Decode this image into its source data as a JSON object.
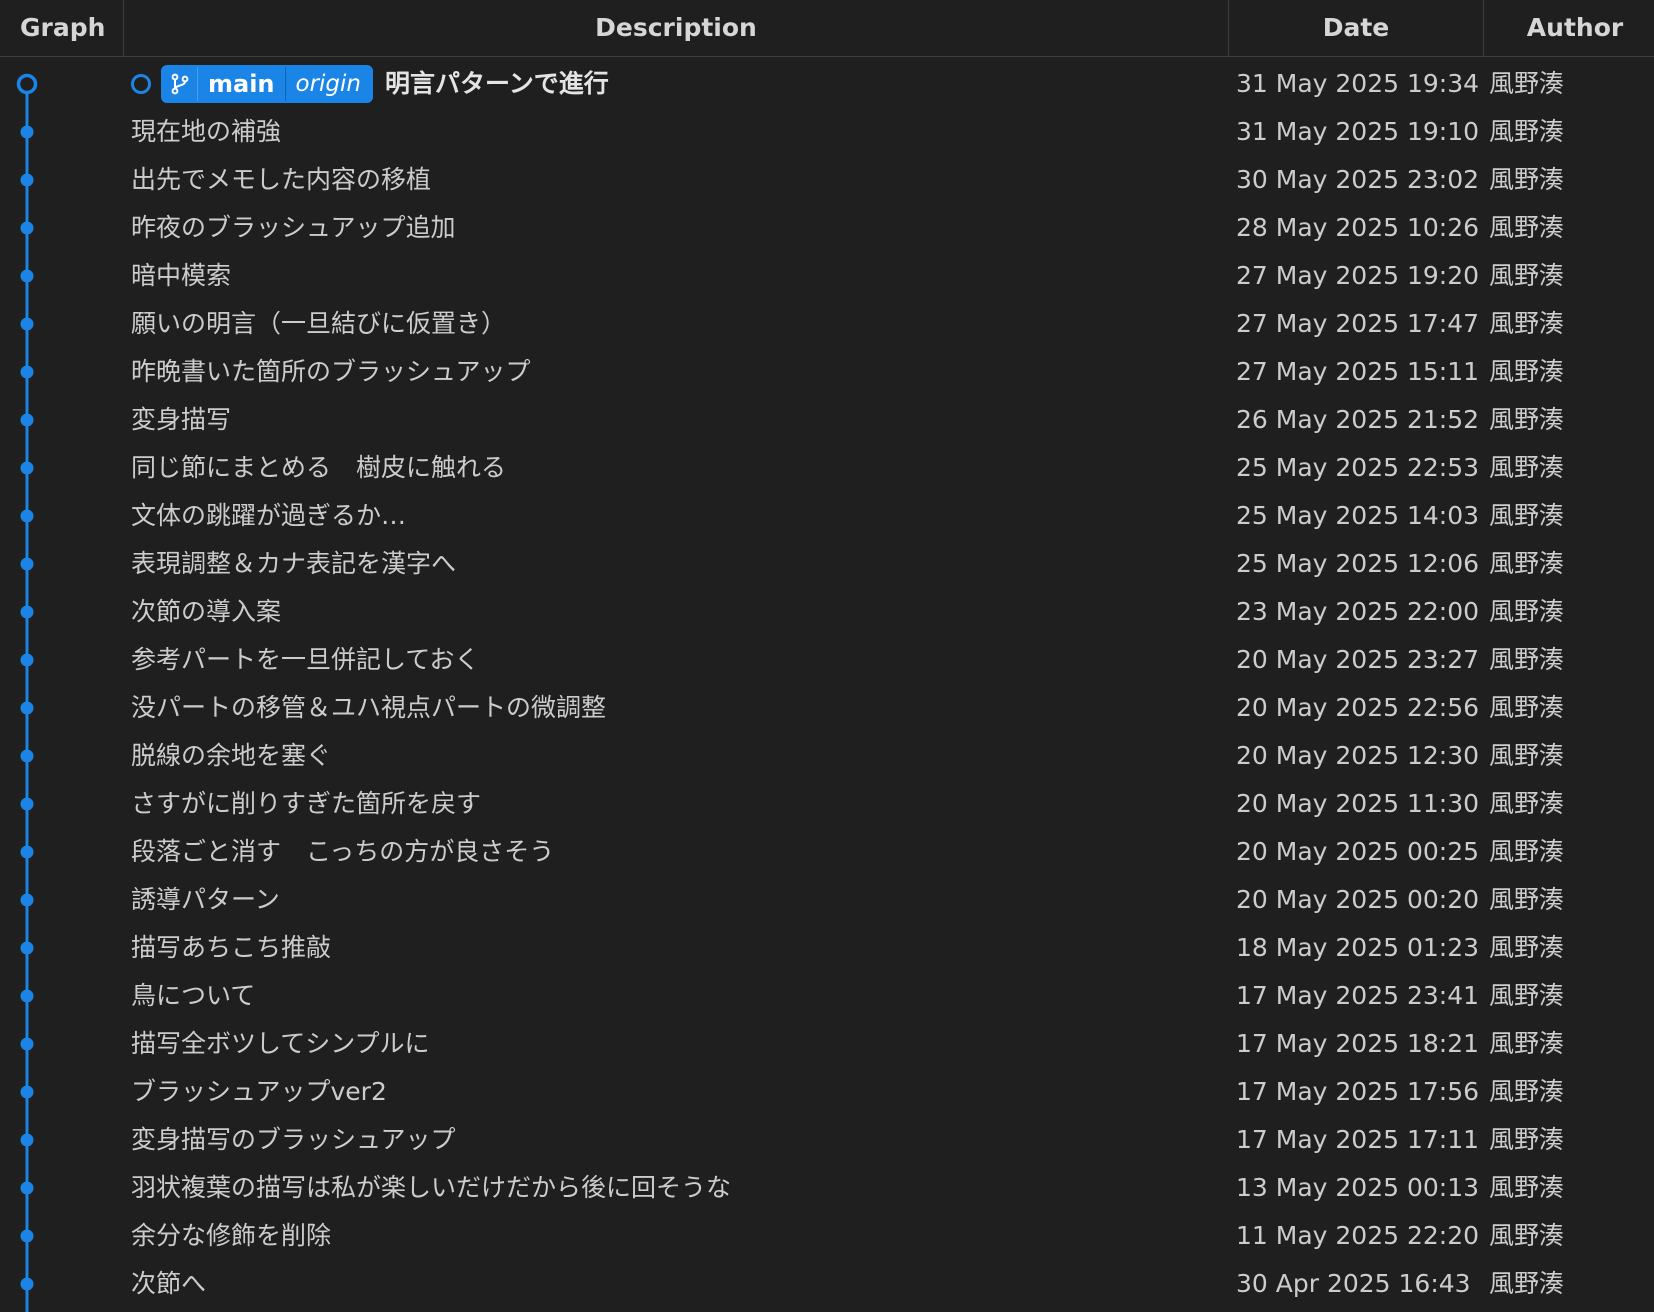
{
  "columns": {
    "graph": "Graph",
    "description": "Description",
    "date": "Date",
    "author": "Author"
  },
  "colors": {
    "accent": "#1a85e6",
    "background": "#1f1f1f"
  },
  "head_badge": {
    "branch_icon": "git-branch-icon",
    "branch": "main",
    "remote": "origin"
  },
  "commits": [
    {
      "description": "明言パターンで進行",
      "date": "31 May 2025 19:34",
      "author": "風野湊"
    },
    {
      "description": "現在地の補強",
      "date": "31 May 2025 19:10",
      "author": "風野湊"
    },
    {
      "description": "出先でメモした内容の移植",
      "date": "30 May 2025 23:02",
      "author": "風野湊"
    },
    {
      "description": "昨夜のブラッシュアップ追加",
      "date": "28 May 2025 10:26",
      "author": "風野湊"
    },
    {
      "description": "暗中模索",
      "date": "27 May 2025 19:20",
      "author": "風野湊"
    },
    {
      "description": "願いの明言（一旦結びに仮置き）",
      "date": "27 May 2025 17:47",
      "author": "風野湊"
    },
    {
      "description": "昨晩書いた箇所のブラッシュアップ",
      "date": "27 May 2025 15:11",
      "author": "風野湊"
    },
    {
      "description": "変身描写",
      "date": "26 May 2025 21:52",
      "author": "風野湊"
    },
    {
      "description": "同じ節にまとめる　樹皮に触れる",
      "date": "25 May 2025 22:53",
      "author": "風野湊"
    },
    {
      "description": "文体の跳躍が過ぎるか…",
      "date": "25 May 2025 14:03",
      "author": "風野湊"
    },
    {
      "description": "表現調整＆カナ表記を漢字へ",
      "date": "25 May 2025 12:06",
      "author": "風野湊"
    },
    {
      "description": "次節の導入案",
      "date": "23 May 2025 22:00",
      "author": "風野湊"
    },
    {
      "description": "参考パートを一旦併記しておく",
      "date": "20 May 2025 23:27",
      "author": "風野湊"
    },
    {
      "description": "没パートの移管＆ユハ視点パートの微調整",
      "date": "20 May 2025 22:56",
      "author": "風野湊"
    },
    {
      "description": "脱線の余地を塞ぐ",
      "date": "20 May 2025 12:30",
      "author": "風野湊"
    },
    {
      "description": "さすがに削りすぎた箇所を戻す",
      "date": "20 May 2025 11:30",
      "author": "風野湊"
    },
    {
      "description": "段落ごと消す　こっちの方が良さそう",
      "date": "20 May 2025 00:25",
      "author": "風野湊"
    },
    {
      "description": "誘導パターン",
      "date": "20 May 2025 00:20",
      "author": "風野湊"
    },
    {
      "description": "描写あちこち推敲",
      "date": "18 May 2025 01:23",
      "author": "風野湊"
    },
    {
      "description": "鳥について",
      "date": "17 May 2025 23:41",
      "author": "風野湊"
    },
    {
      "description": "描写全ボツしてシンプルに",
      "date": "17 May 2025 18:21",
      "author": "風野湊"
    },
    {
      "description": "ブラッシュアップver2",
      "date": "17 May 2025 17:56",
      "author": "風野湊"
    },
    {
      "description": "変身描写のブラッシュアップ",
      "date": "17 May 2025 17:11",
      "author": "風野湊"
    },
    {
      "description": "羽状複葉の描写は私が楽しいだけだから後に回そうな",
      "date": "13 May 2025 00:13",
      "author": "風野湊"
    },
    {
      "description": "余分な修飾を削除",
      "date": "11 May 2025 22:20",
      "author": "風野湊"
    },
    {
      "description": "次節へ",
      "date": "30 Apr 2025 16:43",
      "author": "風野湊"
    }
  ]
}
